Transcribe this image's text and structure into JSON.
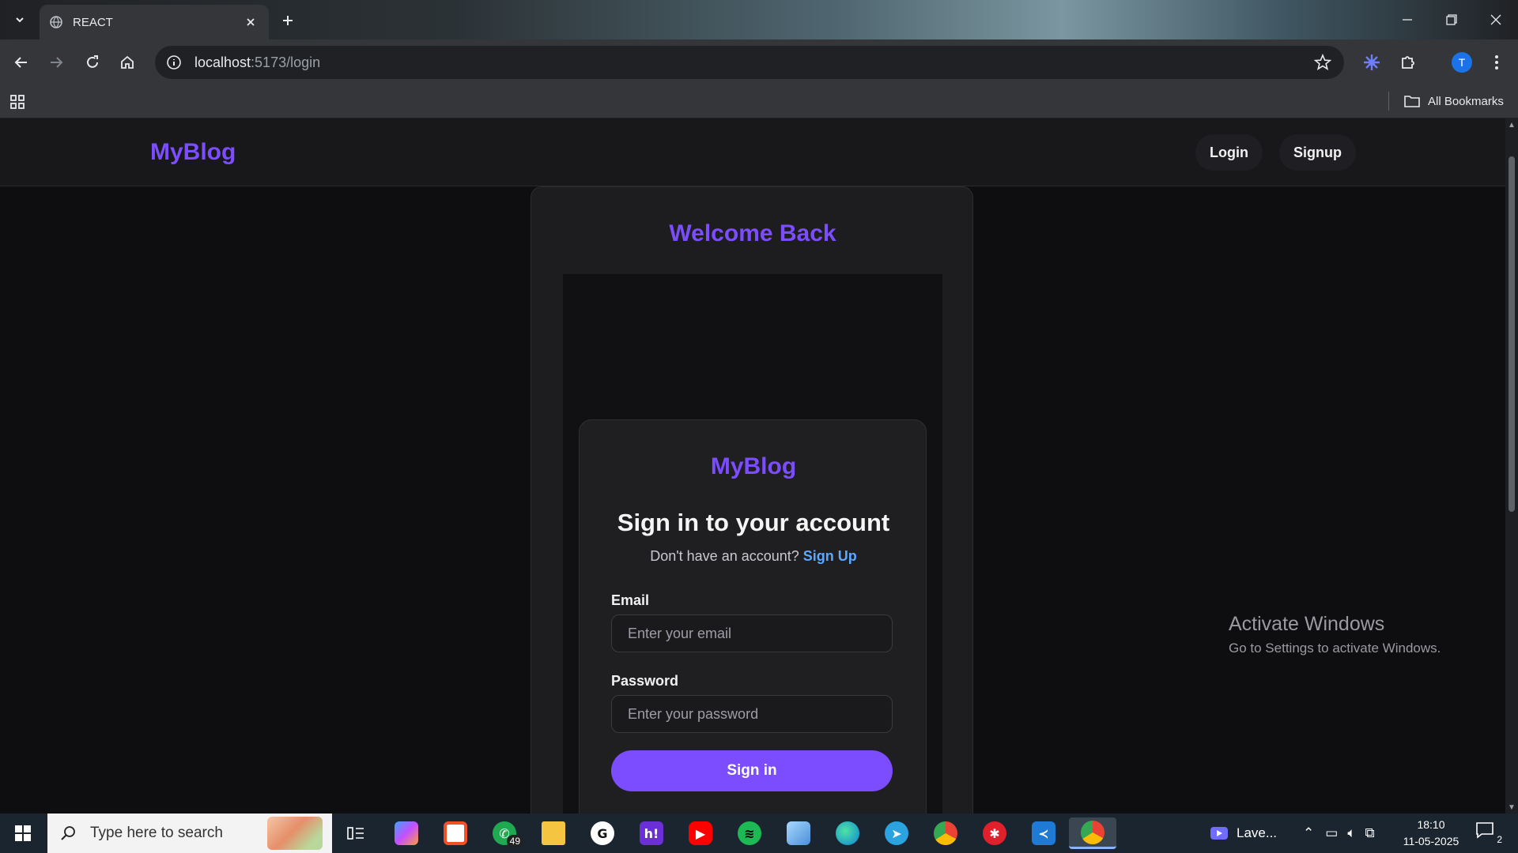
{
  "browser": {
    "tab_title": "REACT",
    "url_host": "localhost",
    "url_path": ":5173/login",
    "profile_initial": "T",
    "bookmarks_label": "All Bookmarks"
  },
  "header": {
    "brand": "MyBlog",
    "nav": [
      {
        "label": "Login"
      },
      {
        "label": "Signup"
      }
    ]
  },
  "page": {
    "welcome": "Welcome Back",
    "card": {
      "brand": "MyBlog",
      "title": "Sign in to your account",
      "subtitle_prefix": "Don't have an account?",
      "subtitle_link": "Sign Up",
      "email_label": "Email",
      "email_placeholder": "Enter your email",
      "password_label": "Password",
      "password_placeholder": "Enter your password",
      "submit_label": "Sign in"
    }
  },
  "watermark": {
    "line1": "Activate Windows",
    "line2": "Go to Settings to activate Windows."
  },
  "taskbar": {
    "search_placeholder": "Type here to search",
    "whatsapp_badge": "49",
    "media_label": "Lave...",
    "time": "18:10",
    "date": "11-05-2025",
    "notifications": "2"
  },
  "colors": {
    "accent": "#7c4dff",
    "link": "#5aa9ff",
    "page_bg": "#0e0e10",
    "card_bg": "#1f1f22"
  }
}
